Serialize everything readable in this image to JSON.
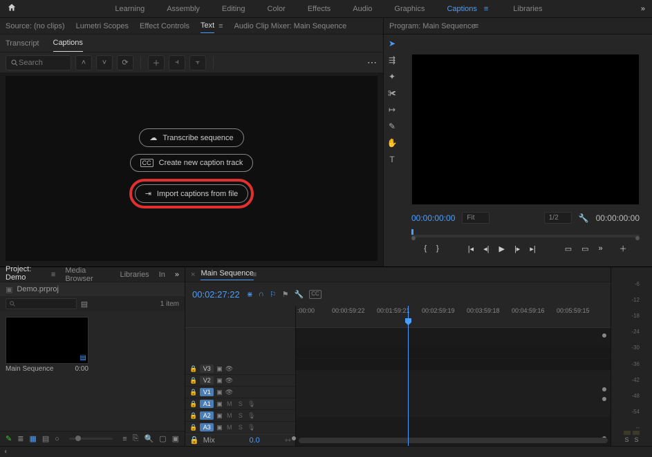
{
  "workspaces": [
    "Learning",
    "Assembly",
    "Editing",
    "Color",
    "Effects",
    "Audio",
    "Graphics",
    "Captions",
    "Libraries"
  ],
  "active_workspace": "Captions",
  "source_tabs": {
    "items": [
      "Source: (no clips)",
      "Lumetri Scopes",
      "Effect Controls",
      "Text",
      "Audio Clip Mixer: Main Sequence"
    ],
    "active": "Text"
  },
  "text_subtabs": {
    "items": [
      "Transcript",
      "Captions"
    ],
    "active": "Captions"
  },
  "caption_toolbar": {
    "search_placeholder": "Search"
  },
  "caption_buttons": {
    "transcribe": "Transcribe sequence",
    "create_track": "Create new caption track",
    "import_file": "Import captions from file"
  },
  "program_panel": {
    "title": "Program: Main Sequence",
    "timecode_in": "00:00:00:00",
    "timecode_out": "00:00:00:00",
    "fit": "Fit",
    "resolution": "1/2"
  },
  "project_panel": {
    "tabs": [
      "Project: Demo",
      "Media Browser",
      "Libraries",
      "In"
    ],
    "active": "Project: Demo",
    "filename": "Demo.prproj",
    "item_count": "1 item",
    "items": [
      {
        "name": "Main Sequence",
        "duration": "0:00"
      }
    ]
  },
  "timeline": {
    "tab": "Main Sequence",
    "playhead_timecode": "00:02:27:22",
    "ruler_ticks": [
      ":00:00",
      "00:00:59:22",
      "00:01:59:21",
      "00:02:59:19",
      "00:03:59:18",
      "00:04:59:16",
      "00:05:59:15"
    ],
    "video_tracks": [
      {
        "name": "V3",
        "on": false
      },
      {
        "name": "V2",
        "on": false
      },
      {
        "name": "V1",
        "on": true
      }
    ],
    "audio_tracks": [
      {
        "name": "A1",
        "on": true
      },
      {
        "name": "A2",
        "on": true
      },
      {
        "name": "A3",
        "on": true
      }
    ],
    "mix_label": "Mix",
    "mix_value": "0.0"
  },
  "audio_meter_marks": [
    "-6",
    "-12",
    "-18",
    "-24",
    "-30",
    "-36",
    "-42",
    "-48",
    "-54",
    "--"
  ],
  "meter_s": "S"
}
